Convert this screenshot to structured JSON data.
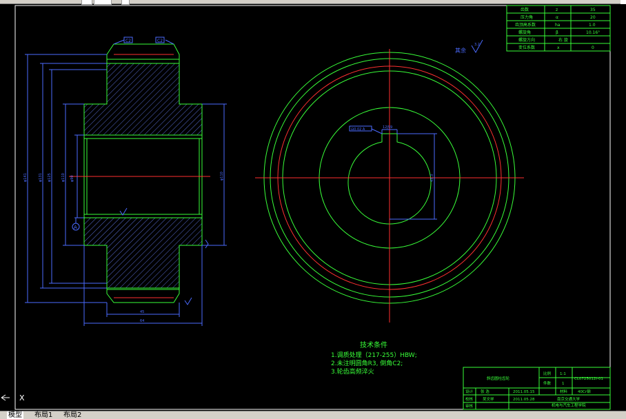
{
  "tabs": [
    {
      "label": "模型",
      "active": true
    },
    {
      "label": "布局1",
      "active": false
    },
    {
      "label": "布局2",
      "active": false
    }
  ],
  "spec_table": {
    "rows": [
      {
        "name": "齿数",
        "symbol": "z",
        "value": "35"
      },
      {
        "name": "压力角",
        "symbol": "α",
        "value": "20"
      },
      {
        "name": "齿顶高系数",
        "symbol": "ha",
        "value": "1.0"
      },
      {
        "name": "螺旋角",
        "symbol": "β",
        "value": "10.16°"
      },
      {
        "name": "螺旋方向",
        "symbol": "",
        "value": "右 旋"
      },
      {
        "name": "变位系数",
        "symbol": "x",
        "value": "0"
      }
    ]
  },
  "surface_note": "其余",
  "tech_req": {
    "title": "技术条件",
    "items": [
      "1.调质处理（217-255）HBW;",
      "2.未注明圆角R3, 倒角C2;",
      "3.轮齿高频淬火"
    ]
  },
  "title_block": {
    "part_name": "斜齿圆柱齿轮",
    "scale_label": "比例",
    "scale": "1:1",
    "drawing_no": "CL0725012Ⅰ-01",
    "qty_label": "件数",
    "qty": "1",
    "designer_label": "设计",
    "designer": "张 浩",
    "design_date": "2011.05.15",
    "material_label": "材料",
    "material": "40Cr钢",
    "checker_label": "校核",
    "checker": "吴文祥",
    "check_date": "2011.05.28",
    "school_line1": "南京交通大学",
    "school_line2": "机电与汽车工程学院",
    "review_label": "审核"
  },
  "dims": {
    "chamfer_left": "C2",
    "chamfer_right": "C2",
    "datum": "A",
    "keyway_tol": "⊟0.02 A",
    "key_width": "12JS9",
    "key_depth": "43.3",
    "roughness": "3.2"
  },
  "ucs_label": "X"
}
